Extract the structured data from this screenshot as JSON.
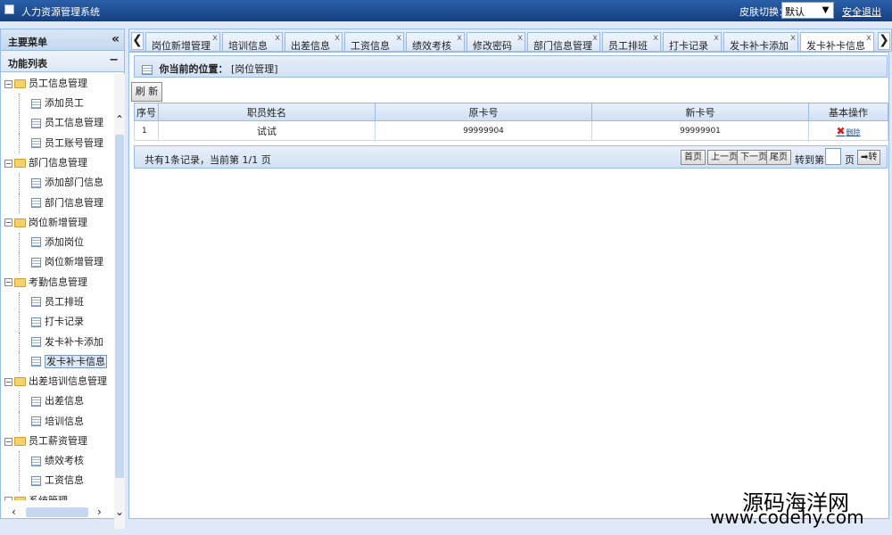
{
  "app": {
    "title": "人力资源管理系统"
  },
  "topbar": {
    "skin_label": "皮肤切换：",
    "skin_value": "默认",
    "logout": "安全退出"
  },
  "sidebar": {
    "header": "主要菜单",
    "collapse_glyph": "«",
    "subheader": "功能列表",
    "minus_glyph": "−",
    "groups": [
      {
        "label": "员工信息管理",
        "items": [
          "添加员工",
          "员工信息管理",
          "员工账号管理"
        ]
      },
      {
        "label": "部门信息管理",
        "items": [
          "添加部门信息",
          "部门信息管理"
        ]
      },
      {
        "label": "岗位新增管理",
        "items": [
          "添加岗位",
          "岗位新增管理"
        ]
      },
      {
        "label": "考勤信息管理",
        "items": [
          "员工排班",
          "打卡记录",
          "发卡补卡添加",
          "发卡补卡信息"
        ]
      },
      {
        "label": "出差培训信息管理",
        "items": [
          "出差信息",
          "培训信息"
        ]
      },
      {
        "label": "员工薪资管理",
        "items": [
          "绩效考核",
          "工资信息"
        ]
      },
      {
        "label": "系统管理",
        "items": []
      }
    ],
    "selected_item": "发卡补卡信息"
  },
  "tabs": {
    "prev_glyph": "❮",
    "next_glyph": "❯",
    "close_glyph": "x",
    "items": [
      "岗位新增管理",
      "培训信息",
      "出差信息",
      "工资信息",
      "绩效考核",
      "修改密码",
      "部门信息管理",
      "员工排班",
      "打卡记录",
      "发卡补卡添加",
      "发卡补卡信息"
    ],
    "active": "发卡补卡信息"
  },
  "location": {
    "label": "你当前的位置：",
    "value": "[岗位管理]"
  },
  "toolbar": {
    "refresh": "刷 新"
  },
  "table": {
    "columns": [
      "序号",
      "职员姓名",
      "原卡号",
      "新卡号",
      "基本操作"
    ],
    "rows": [
      {
        "index": "1",
        "name": "试试",
        "old_card": "99999904",
        "new_card": "99999901",
        "action": "删除"
      }
    ]
  },
  "pager": {
    "summary": "共有1条记录，当前第 1/1 页",
    "first": "首页",
    "prev": "上一页",
    "next": "下一页",
    "last": "尾页",
    "goto_label": "转到第",
    "page_unit": "页",
    "go": "➡转"
  },
  "watermark": {
    "line1": "源码海洋网",
    "line2": "www.codehy.com"
  }
}
